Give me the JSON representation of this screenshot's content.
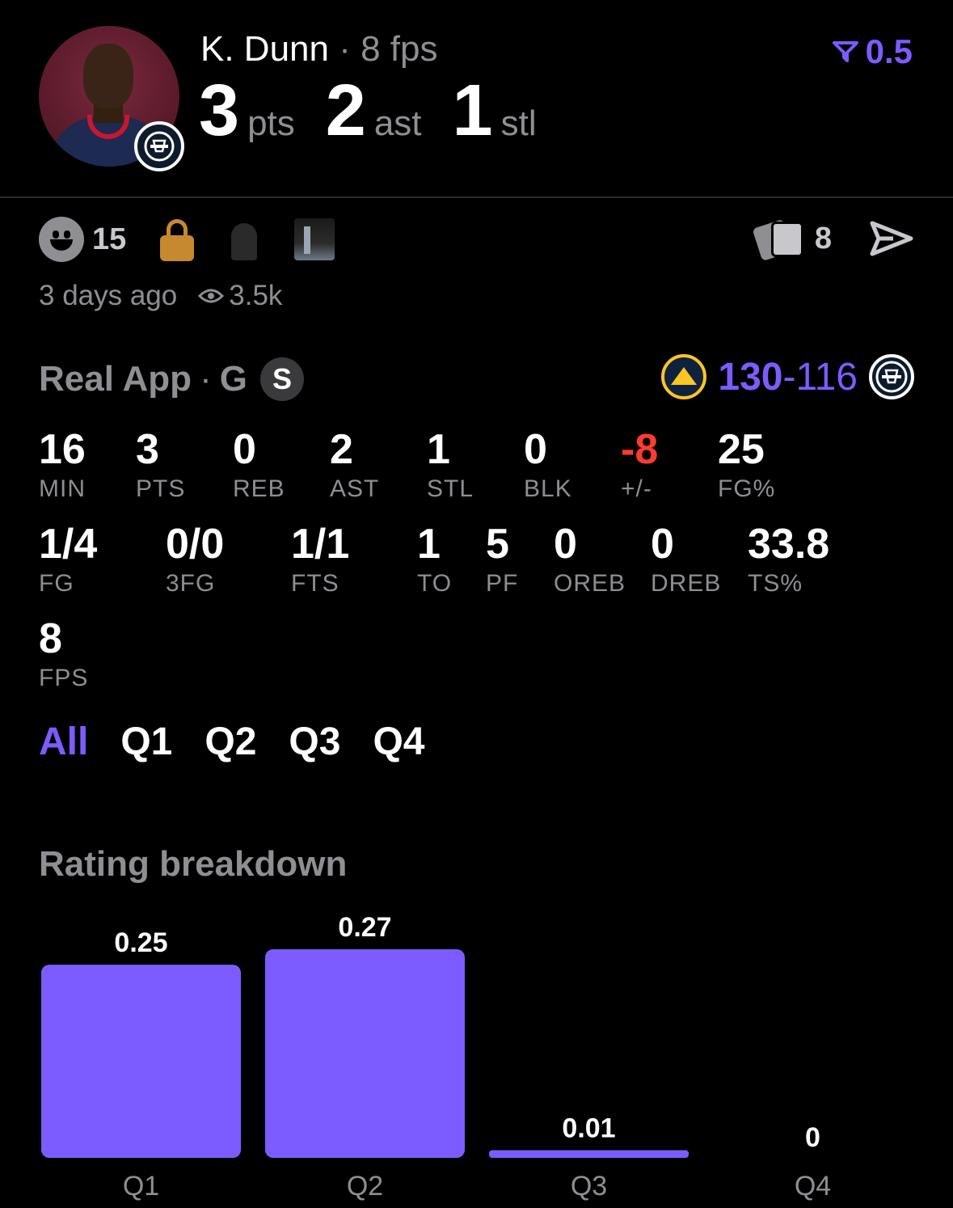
{
  "header": {
    "player_name": "K. Dunn",
    "separator": "·",
    "player_fps": "8 fps",
    "projection_value": "0.5",
    "stat_line": [
      {
        "value": "3",
        "unit": "pts"
      },
      {
        "value": "2",
        "unit": "ast"
      },
      {
        "value": "1",
        "unit": "stl"
      }
    ]
  },
  "social": {
    "reactions_count": "15",
    "cards_count": "8",
    "posted": "3 days ago",
    "views": "3.5k"
  },
  "game": {
    "app": "Real App",
    "separator": "·",
    "position": "G",
    "badge": "S",
    "home_score": "130",
    "dash": "-",
    "away_score": "116"
  },
  "stats_row1": [
    {
      "value": "16",
      "label": "MIN"
    },
    {
      "value": "3",
      "label": "PTS"
    },
    {
      "value": "0",
      "label": "REB"
    },
    {
      "value": "2",
      "label": "AST"
    },
    {
      "value": "1",
      "label": "STL"
    },
    {
      "value": "0",
      "label": "BLK"
    },
    {
      "value": "-8",
      "label": "+/-"
    },
    {
      "value": "25",
      "label": "FG%"
    }
  ],
  "stats_row2": [
    {
      "value": "1/4",
      "label": "FG"
    },
    {
      "value": "0/0",
      "label": "3FG"
    },
    {
      "value": "1/1",
      "label": "FTS"
    },
    {
      "value": "1",
      "label": "TO"
    },
    {
      "value": "5",
      "label": "PF"
    },
    {
      "value": "0",
      "label": "OREB"
    },
    {
      "value": "0",
      "label": "DREB"
    },
    {
      "value": "33.8",
      "label": "TS%"
    }
  ],
  "stats_row3": [
    {
      "value": "8",
      "label": "FPS"
    }
  ],
  "tabs": [
    "All",
    "Q1",
    "Q2",
    "Q3",
    "Q4"
  ],
  "section_title": "Rating breakdown",
  "colors": {
    "accent": "#7c5cff",
    "negative": "#ff3b30",
    "muted": "#8e8e93"
  },
  "chart_data": {
    "type": "bar",
    "title": "Rating breakdown",
    "categories": [
      "Q1",
      "Q2",
      "Q3",
      "Q4"
    ],
    "values": [
      0.25,
      0.27,
      0.01,
      0
    ],
    "value_labels": [
      "0.25",
      "0.27",
      "0.01",
      "0"
    ],
    "color": "#7c5cff",
    "ylim": [
      0,
      0.27
    ],
    "grid": false
  }
}
